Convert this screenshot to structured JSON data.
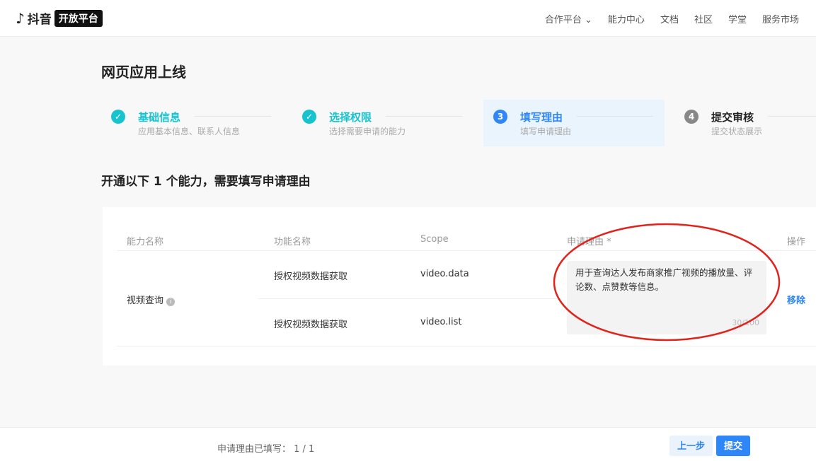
{
  "header": {
    "brand": "抖音",
    "brand_tag": "开放平台",
    "nav": [
      "合作平台",
      "能力中心",
      "文档",
      "社区",
      "学堂",
      "服务市场"
    ]
  },
  "page_title": "网页应用上线",
  "steps": [
    {
      "num": "✓",
      "title": "基础信息",
      "desc": "应用基本信息、联系人信息",
      "state": "done"
    },
    {
      "num": "✓",
      "title": "选择权限",
      "desc": "选择需要申请的能力",
      "state": "done"
    },
    {
      "num": "3",
      "title": "填写理由",
      "desc": "填写申请理由",
      "state": "active"
    },
    {
      "num": "4",
      "title": "提交审核",
      "desc": "提交状态展示",
      "state": "pending"
    }
  ],
  "section_title": "开通以下 1 个能力，需要填写申请理由",
  "table": {
    "headers": [
      "能力名称",
      "功能名称",
      "Scope",
      "申请理由 *",
      "操作"
    ],
    "ability": "视频查询",
    "rows": [
      {
        "func": "授权视频数据获取",
        "scope": "video.data"
      },
      {
        "func": "授权视频数据获取",
        "scope": "video.list"
      }
    ],
    "reason": "用于查询达人发布商家推广视频的播放量、评论数、点赞数等信息。",
    "reason_count": "30/100",
    "action": "移除"
  },
  "footer": {
    "status": "申请理由已填写： 1 / 1",
    "prev": "上一步",
    "submit": "提交"
  },
  "colors": {
    "done": "#17c3cf",
    "active": "#2f86f6",
    "pending": "#888888",
    "annotation": "#e0231b"
  }
}
